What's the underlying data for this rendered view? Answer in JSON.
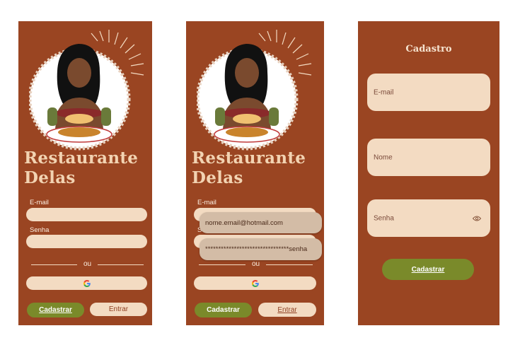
{
  "brand": {
    "line1": "Restaurante",
    "line2": "Delas"
  },
  "login": {
    "email_label": "E-mail",
    "password_label": "Senha",
    "or_text": "ou",
    "register_button": "Cadastrar",
    "enter_button": "Entrar"
  },
  "autofill": {
    "email_suggestion": "nome.email@hotmail.com",
    "password_suggestion": "********************************senha"
  },
  "register": {
    "title": "Cadastro",
    "email_placeholder": "E-mail",
    "name_placeholder": "Nome",
    "password_placeholder": "Senha",
    "submit_button": "Cadastrar"
  },
  "colors": {
    "background": "#9a4522",
    "field": "#f3dbc2",
    "accent_green": "#7a8a2a",
    "brand_text": "#f2d3b2"
  },
  "icons": [
    "google-icon",
    "eye-icon",
    "restaurant-logo"
  ]
}
